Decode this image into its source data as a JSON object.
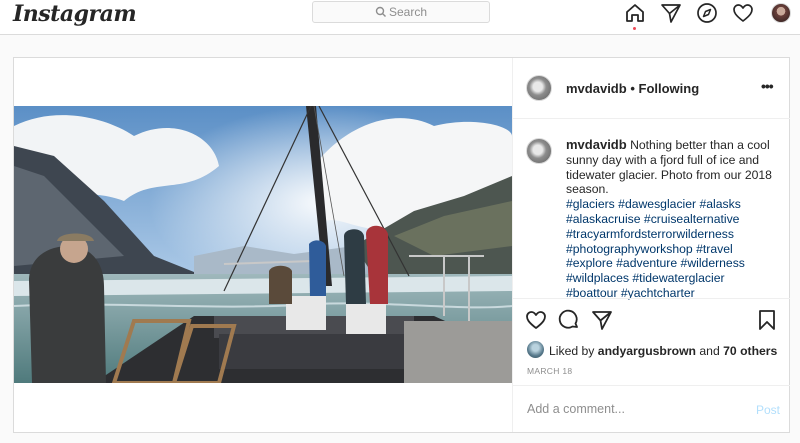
{
  "app": {
    "logo": "Instagram"
  },
  "search": {
    "placeholder": "Search"
  },
  "nav": {
    "icons": [
      "home-icon",
      "direct-icon",
      "explore-icon",
      "activity-heart-icon",
      "profile-avatar"
    ],
    "active": "home-icon",
    "accent": "#ed4956"
  },
  "post": {
    "username": "mvdavidb",
    "follow_status": "Following",
    "separator": "•",
    "more": "•••",
    "caption_user": "mvdavidb",
    "caption_text": "Nothing better than a cool sunny day with a fjord full of ice and tidewater glacier. Photo from our 2018 season.",
    "hashtags": [
      "#glaciers",
      "#dawesglacier",
      "#alasks",
      "#alaskacruise",
      "#cruisealternative",
      "#tracyarmfordsterrorwilderness",
      "#photographyworkshop",
      "#travel",
      "#explore",
      "#adventure",
      "#wilderness",
      "#wildplaces",
      "#tidewaterglacier",
      "#boattour",
      "#yachtcharter"
    ],
    "liked_prefix": "Liked by",
    "liked_user": "andyargusbrown",
    "liked_joiner": "and",
    "liked_others": "70 others",
    "date": "MARCH 18",
    "comment_placeholder": "Add a comment...",
    "post_button": "Post"
  },
  "colors": {
    "link": "#00376b",
    "post_button": "#b2dffc",
    "border": "#dbdbdb"
  }
}
